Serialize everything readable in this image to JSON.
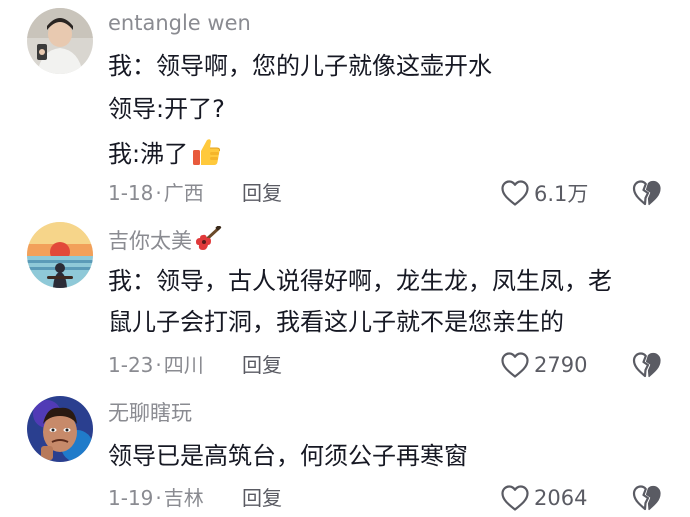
{
  "comments": [
    {
      "username": "entangle wen",
      "lines": [
        "我：领导啊，您的儿子就像这壶开水",
        "领导:开了?",
        "我:沸了"
      ],
      "date": "1-18",
      "location": "广西",
      "reply_label": "回复",
      "likes": "6.1万",
      "avatar_icon": "person-photo-avatar",
      "inline_emoji": "thumbs-up-icon"
    },
    {
      "username": "吉你太美",
      "username_emoji": "guitar-icon",
      "lines": [
        "我：领导，古人说得好啊，龙生龙，凤生凤，老",
        "鼠儿子会打洞，我看这儿子就不是您亲生的"
      ],
      "date": "1-23",
      "location": "四川",
      "reply_label": "回复",
      "likes": "2790",
      "avatar_icon": "sunset-guitarist-avatar"
    },
    {
      "username": "无聊瞎玩",
      "lines": [
        "领导已是高筑台，何须公子再寒窗"
      ],
      "date": "1-19",
      "location": "吉林",
      "reply_label": "回复",
      "likes": "2064",
      "avatar_icon": "cartoon-face-avatar"
    }
  ],
  "meta_separator": "·",
  "colors": {
    "secondary_text": "#8a8b91",
    "primary_text": "#161823",
    "icon": "#5a5b63"
  }
}
